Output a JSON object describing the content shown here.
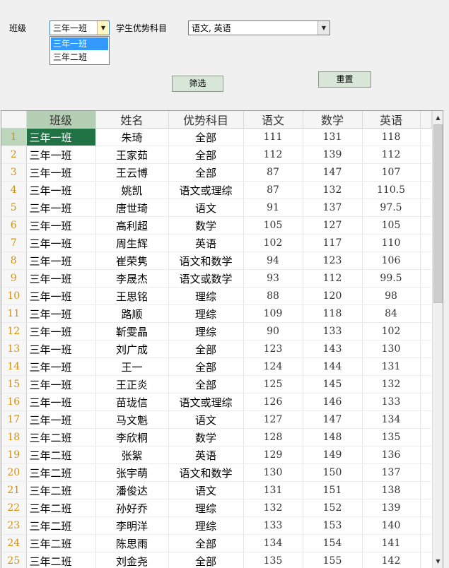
{
  "filters": {
    "class_label": "班级",
    "class_value": "三年一班",
    "class_options": [
      "三年一班",
      "三年二班"
    ],
    "subject_label": "学生优势科目",
    "subject_value": "语文, 英语",
    "filter_button": "筛选",
    "reset_button": "重置"
  },
  "grid": {
    "columns": [
      "班级",
      "姓名",
      "优势科目",
      "语文",
      "数学",
      "英语"
    ],
    "rows": [
      {
        "n": "1",
        "cls": "三年一班",
        "name": "朱琦",
        "adv": "全部",
        "cn": "111",
        "math": "131",
        "en": "118"
      },
      {
        "n": "2",
        "cls": "三年一班",
        "name": "王家茹",
        "adv": "全部",
        "cn": "112",
        "math": "139",
        "en": "112"
      },
      {
        "n": "3",
        "cls": "三年一班",
        "name": "王云博",
        "adv": "全部",
        "cn": "87",
        "math": "147",
        "en": "107"
      },
      {
        "n": "4",
        "cls": "三年一班",
        "name": "姚凯",
        "adv": "语文或理综",
        "cn": "87",
        "math": "132",
        "en": "110.5"
      },
      {
        "n": "5",
        "cls": "三年一班",
        "name": "唐世琦",
        "adv": "语文",
        "cn": "91",
        "math": "137",
        "en": "97.5"
      },
      {
        "n": "6",
        "cls": "三年一班",
        "name": "高利超",
        "adv": "数学",
        "cn": "105",
        "math": "127",
        "en": "105"
      },
      {
        "n": "7",
        "cls": "三年一班",
        "name": "周生辉",
        "adv": "英语",
        "cn": "102",
        "math": "117",
        "en": "110"
      },
      {
        "n": "8",
        "cls": "三年一班",
        "name": "崔荣隽",
        "adv": "语文和数学",
        "cn": "94",
        "math": "123",
        "en": "106"
      },
      {
        "n": "9",
        "cls": "三年一班",
        "name": "李晟杰",
        "adv": "语文或数学",
        "cn": "93",
        "math": "112",
        "en": "99.5"
      },
      {
        "n": "10",
        "cls": "三年一班",
        "name": "王思铭",
        "adv": "理综",
        "cn": "88",
        "math": "120",
        "en": "98"
      },
      {
        "n": "11",
        "cls": "三年一班",
        "name": "路顺",
        "adv": "理综",
        "cn": "109",
        "math": "118",
        "en": "84"
      },
      {
        "n": "12",
        "cls": "三年一班",
        "name": "靳雯晶",
        "adv": "理综",
        "cn": "90",
        "math": "133",
        "en": "102"
      },
      {
        "n": "13",
        "cls": "三年一班",
        "name": "刘广成",
        "adv": "全部",
        "cn": "123",
        "math": "143",
        "en": "130"
      },
      {
        "n": "14",
        "cls": "三年一班",
        "name": "王一",
        "adv": "全部",
        "cn": "124",
        "math": "144",
        "en": "131"
      },
      {
        "n": "15",
        "cls": "三年一班",
        "name": "王正炎",
        "adv": "全部",
        "cn": "125",
        "math": "145",
        "en": "132"
      },
      {
        "n": "16",
        "cls": "三年一班",
        "name": "苗珑信",
        "adv": "语文或理综",
        "cn": "126",
        "math": "146",
        "en": "133"
      },
      {
        "n": "17",
        "cls": "三年一班",
        "name": "马文魁",
        "adv": "语文",
        "cn": "127",
        "math": "147",
        "en": "134"
      },
      {
        "n": "18",
        "cls": "三年二班",
        "name": "李欣桐",
        "adv": "数学",
        "cn": "128",
        "math": "148",
        "en": "135"
      },
      {
        "n": "19",
        "cls": "三年二班",
        "name": "张絮",
        "adv": "英语",
        "cn": "129",
        "math": "149",
        "en": "136"
      },
      {
        "n": "20",
        "cls": "三年二班",
        "name": "张宇萌",
        "adv": "语文和数学",
        "cn": "130",
        "math": "150",
        "en": "137"
      },
      {
        "n": "21",
        "cls": "三年二班",
        "name": "潘俊达",
        "adv": "语文",
        "cn": "131",
        "math": "151",
        "en": "138"
      },
      {
        "n": "22",
        "cls": "三年二班",
        "name": "孙好乔",
        "adv": "理综",
        "cn": "132",
        "math": "152",
        "en": "139"
      },
      {
        "n": "23",
        "cls": "三年二班",
        "name": "李明洋",
        "adv": "理综",
        "cn": "133",
        "math": "153",
        "en": "140"
      },
      {
        "n": "24",
        "cls": "三年二班",
        "name": "陈思雨",
        "adv": "全部",
        "cn": "134",
        "math": "154",
        "en": "141"
      },
      {
        "n": "25",
        "cls": "三年二班",
        "name": "刘金尧",
        "adv": "全部",
        "cn": "135",
        "math": "155",
        "en": "142"
      }
    ]
  },
  "icons": {
    "dropdown": "chevron-down-icon",
    "scroll_up": "arrow-up-icon",
    "scroll_down": "arrow-down-icon"
  },
  "colors": {
    "selected_cell": "#217346",
    "row_number": "#d4910c",
    "active_header": "#b5cfb5",
    "button_bg": "#d8e6d8"
  }
}
